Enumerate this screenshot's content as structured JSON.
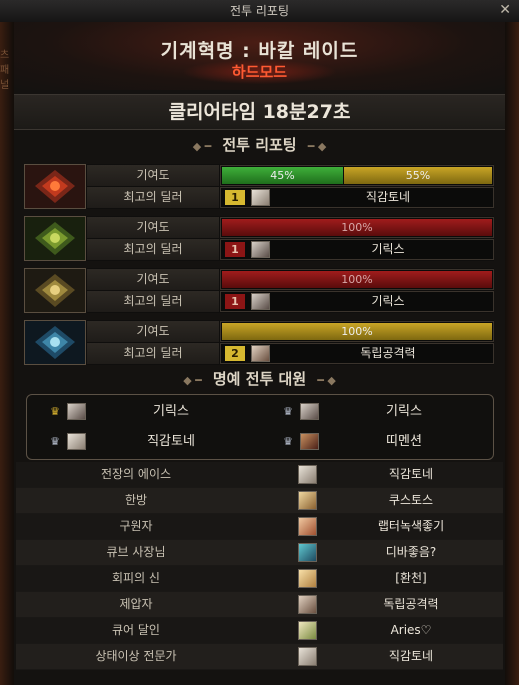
{
  "window": {
    "title": "전투 리포팅",
    "close_label": "✕",
    "side_text": "츠패널"
  },
  "raid": {
    "name": "기계혁명 : 바칼 레이드",
    "mode": "하드모드"
  },
  "clear_time": "클리어타임  18분27초",
  "report_section_title": "전투 리포팅",
  "report_labels": {
    "contribution": "기여도",
    "best_dealer": "최고의 딜러"
  },
  "parties": [
    {
      "contribution": [
        {
          "label": "45%",
          "percent": 45,
          "color": "green"
        },
        {
          "label": "55%",
          "percent": 55,
          "color": "gold"
        }
      ],
      "rank": "1",
      "rank_style": "gold",
      "dealer": "직감토네"
    },
    {
      "contribution": [
        {
          "label": "100%",
          "percent": 100,
          "color": "red"
        }
      ],
      "rank": "1",
      "rank_style": "red",
      "dealer": "기릭스"
    },
    {
      "contribution": [
        {
          "label": "100%",
          "percent": 100,
          "color": "red"
        }
      ],
      "rank": "1",
      "rank_style": "red",
      "dealer": "기릭스"
    },
    {
      "contribution": [
        {
          "label": "100%",
          "percent": 100,
          "color": "gold"
        }
      ],
      "rank": "2",
      "rank_style": "gold",
      "dealer": "독립공격력"
    }
  ],
  "honor_section_title": "명예 전투 대원",
  "honor_members": [
    {
      "name": "기릭스",
      "crown": "gold"
    },
    {
      "name": "기릭스",
      "crown": "silver"
    },
    {
      "name": "직감토네",
      "crown": "silver"
    },
    {
      "name": "띠멘션",
      "crown": "silver"
    }
  ],
  "awards": [
    {
      "title": "전장의 에이스",
      "name": "직감토네"
    },
    {
      "title": "한방",
      "name": "쿠스토스"
    },
    {
      "title": "구원자",
      "name": "랩터녹색좋기"
    },
    {
      "title": "큐브 사장님",
      "name": "디바좋음?"
    },
    {
      "title": "회피의 신",
      "name": "[환천]"
    },
    {
      "title": "제압자",
      "name": "독립공격력"
    },
    {
      "title": "큐어 달인",
      "name": "Aries♡"
    },
    {
      "title": "상태이상 전문가",
      "name": "직감토네"
    }
  ],
  "colors": {
    "accent_mode": "#ff5a32",
    "green": "#3fb03a",
    "gold": "#c9a526",
    "red": "#a01c1c"
  },
  "icons": {
    "close": "close-icon",
    "crown_gold": "crown-gold-icon",
    "crown_silver": "crown-silver-icon",
    "ornament": "diamond-ornament-icon"
  }
}
